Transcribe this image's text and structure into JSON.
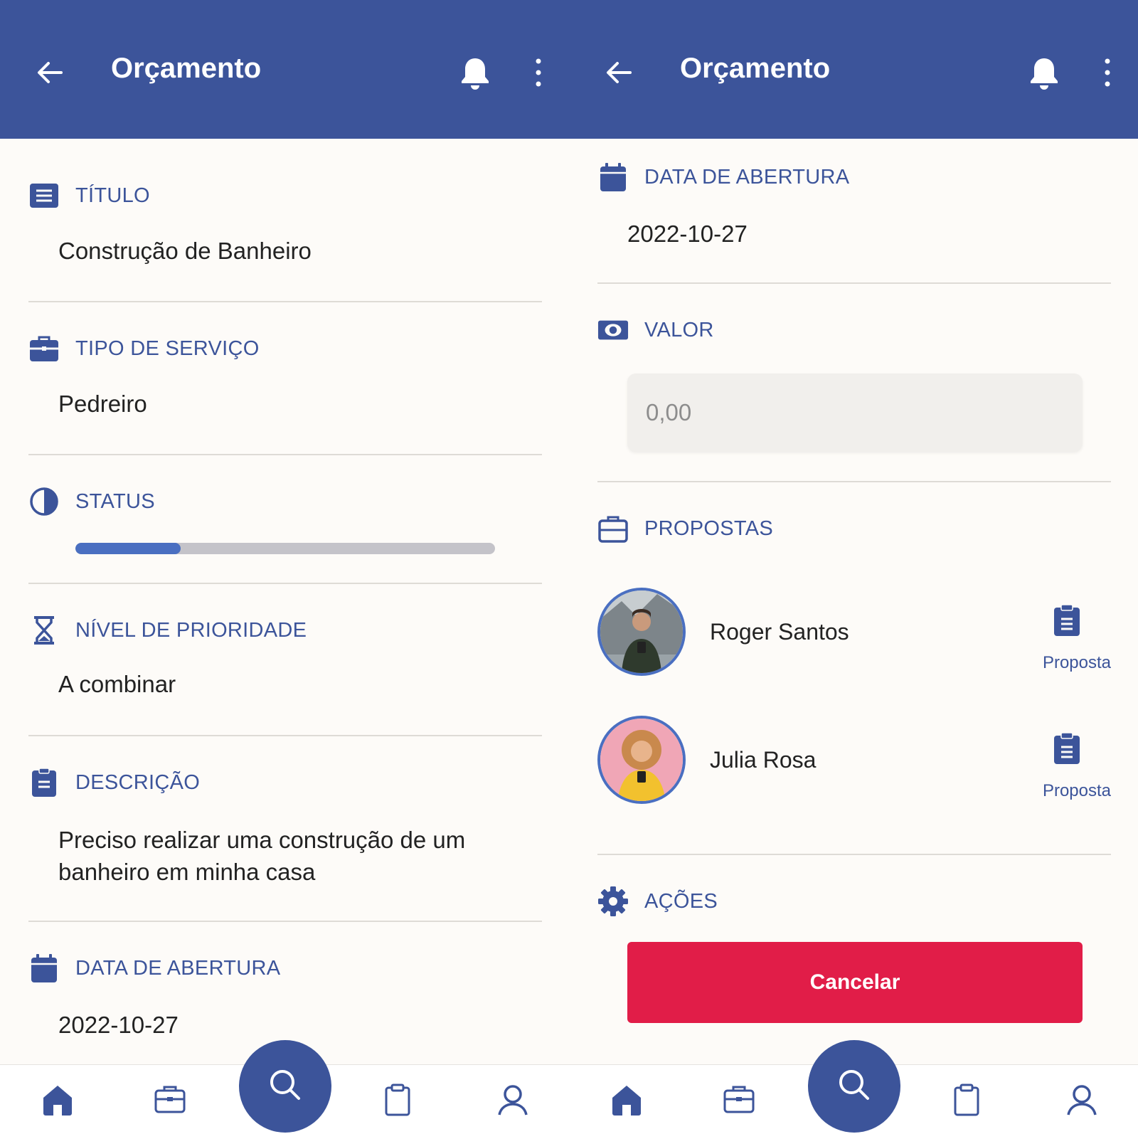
{
  "colors": {
    "primary": "#3c549a",
    "accent": "#4a6fc1",
    "danger": "#e11d48",
    "background": "#fdfbf8",
    "divider": "#dedbd6"
  },
  "left": {
    "appbar": {
      "title": "Orçamento"
    },
    "titulo": {
      "label": "TÍTULO",
      "value": "Construção de Banheiro"
    },
    "tipo": {
      "label": "TIPO DE SERVIÇO",
      "value": "Pedreiro"
    },
    "status": {
      "label": "STATUS",
      "progress_percent": 25
    },
    "prioridade": {
      "label": "NÍVEL DE PRIORIDADE",
      "value": "A combinar"
    },
    "descricao": {
      "label": "DESCRIÇÃO",
      "value": "Preciso realizar uma construção de um banheiro em minha casa"
    },
    "data": {
      "label": "DATA DE ABERTURA",
      "value": "2022-10-27"
    }
  },
  "right": {
    "appbar": {
      "title": "Orçamento"
    },
    "data": {
      "label": "DATA DE ABERTURA",
      "value": "2022-10-27"
    },
    "valor": {
      "label": "VALOR",
      "placeholder": "0,00"
    },
    "propostas": {
      "label": "PROPOSTAS",
      "items": [
        {
          "name": "Roger Santos",
          "action": "Proposta"
        },
        {
          "name": "Julia Rosa",
          "action": "Proposta"
        }
      ]
    },
    "acoes": {
      "label": "AÇÕES",
      "cancel_label": "Cancelar"
    }
  },
  "nav": {
    "items": [
      "home-icon",
      "briefcase-icon",
      "search-icon",
      "clipboard-icon",
      "user-icon"
    ]
  }
}
